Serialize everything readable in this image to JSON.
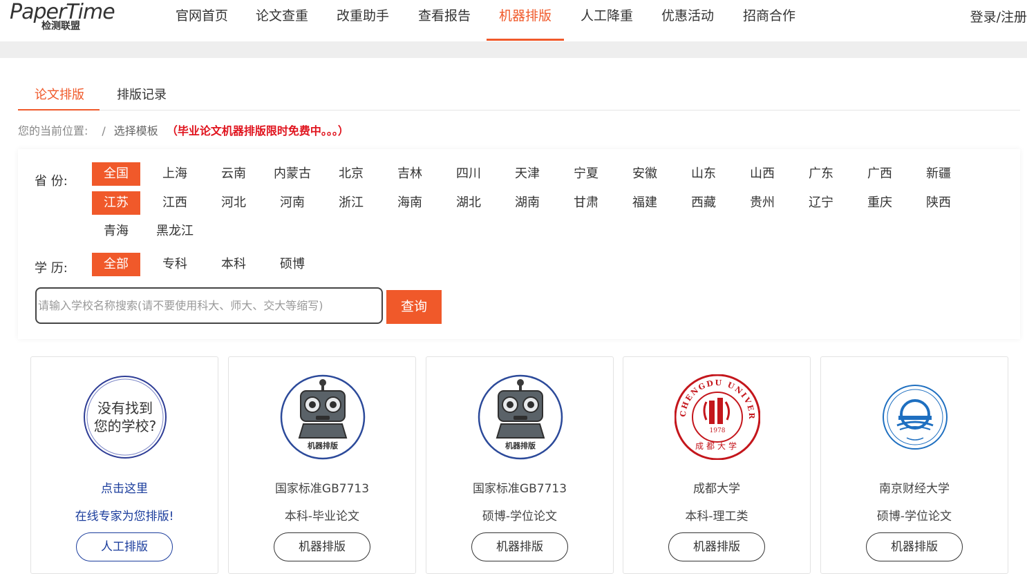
{
  "header": {
    "logo_main": "PaperTime",
    "logo_sub": "检测联盟",
    "nav": [
      {
        "label": "官网首页"
      },
      {
        "label": "论文查重"
      },
      {
        "label": "改重助手"
      },
      {
        "label": "查看报告"
      },
      {
        "label": "机器排版",
        "active": true
      },
      {
        "label": "人工降重"
      },
      {
        "label": "优惠活动"
      },
      {
        "label": "招商合作"
      }
    ],
    "login_label": "登录/注册"
  },
  "tabs": [
    {
      "label": "论文排版",
      "active": true
    },
    {
      "label": "排版记录"
    }
  ],
  "breadcrumb": {
    "prefix": "您的当前位置:",
    "separator": "/",
    "current": "选择模板",
    "notice": "（毕业论文机器排版限时免费中。。。）"
  },
  "filters": {
    "province_label": "省 份:",
    "provinces": [
      "全国",
      "上海",
      "云南",
      "内蒙古",
      "北京",
      "吉林",
      "四川",
      "天津",
      "宁夏",
      "安徽",
      "山东",
      "山西",
      "广东",
      "广西",
      "新疆",
      "江苏",
      "江西",
      "河北",
      "河南",
      "浙江",
      "海南",
      "湖北",
      "湖南",
      "甘肃",
      "福建",
      "西藏",
      "贵州",
      "辽宁",
      "重庆",
      "陕西",
      "青海",
      "黑龙江"
    ],
    "province_active": [
      "全国",
      "江苏"
    ],
    "edu_label": "学 历:",
    "edu": [
      "全部",
      "专科",
      "本科",
      "硕博"
    ],
    "edu_active": "全部"
  },
  "search": {
    "placeholder": "请输入学校名称搜索(请不要使用科大、师大、交大等缩写)",
    "button_label": "查询"
  },
  "cards": [
    {
      "emblem_text_1": "没有找到",
      "emblem_text_2": "您的学校?",
      "line1": "点击这里",
      "line2": "在线专家为您排版!",
      "button": "人工排版",
      "style": "blue",
      "icon": "not-found-icon"
    },
    {
      "emblem_caption": "机器排版",
      "line1": "国家标准GB7713",
      "line2": "本科-毕业论文",
      "button": "机器排版",
      "icon": "robot-icon"
    },
    {
      "emblem_caption": "机器排版",
      "line1": "国家标准GB7713",
      "line2": "硕博-学位论文",
      "button": "机器排版",
      "icon": "robot-icon"
    },
    {
      "emblem_ring": "CHENGDU UNIVERSITY",
      "emblem_year": "1978",
      "emblem_cn": "成都大学",
      "line1": "成都大学",
      "line2": "本科-理工类",
      "button": "机器排版",
      "icon": "chengdu-university-emblem-icon"
    },
    {
      "line1": "南京财经大学",
      "line2": "硕博-学位论文",
      "button": "机器排版",
      "icon": "nufe-emblem-icon"
    }
  ],
  "colors": {
    "accent": "#f0592a",
    "link_blue": "#1a3c9c",
    "notice_red": "#e0141e"
  }
}
